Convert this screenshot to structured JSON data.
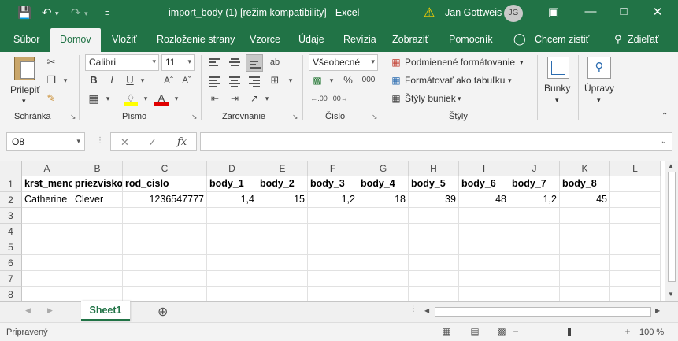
{
  "titlebar": {
    "title": "import_body (1)  [režim kompatibility]  -  Excel",
    "user": "Jan Gottweis",
    "initials": "JG"
  },
  "tabs": [
    "Súbor",
    "Domov",
    "Vložiť",
    "Rozloženie strany",
    "Vzorce",
    "Údaje",
    "Revízia",
    "Zobraziť",
    "Pomocník",
    "Chcem zistiť",
    "Zdieľať"
  ],
  "ribbon": {
    "paste_label": "Prilepiť",
    "font_name": "Calibri",
    "font_size": "11",
    "number_format": "Všeobecné",
    "cond_format": "Podmienené formátovanie",
    "format_table": "Formátovať ako tabuľku",
    "cell_styles": "Štýly buniek",
    "cells_label": "Bunky",
    "editing_label": "Úpravy",
    "groups": {
      "clipboard": "Schránka",
      "font": "Písmo",
      "alignment": "Zarovnanie",
      "number": "Číslo",
      "styles": "Štýly"
    }
  },
  "formula_bar": {
    "name_box": "O8",
    "fx": "fx",
    "formula": ""
  },
  "grid": {
    "columns": [
      "A",
      "B",
      "C",
      "D",
      "E",
      "F",
      "G",
      "H",
      "I",
      "J",
      "K",
      "L"
    ],
    "rows": [
      "1",
      "2",
      "3",
      "4",
      "5",
      "6",
      "7",
      "8"
    ],
    "header_row": [
      "krst_meno",
      "priezvisko",
      "rod_cislo",
      "body_1",
      "body_2",
      "body_3",
      "body_4",
      "body_5",
      "body_6",
      "body_7",
      "body_8"
    ],
    "data_row": [
      "Catherine",
      "Clever",
      "1236547777",
      "1,4",
      "15",
      "1,2",
      "18",
      "39",
      "48",
      "1,2",
      "45"
    ]
  },
  "sheets": [
    "Sheet1"
  ],
  "status": {
    "ready": "Pripravený",
    "zoom": "100 %"
  }
}
